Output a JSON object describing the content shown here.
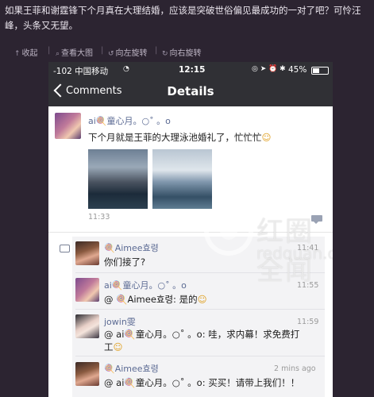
{
  "post": {
    "text": "如果王菲和谢霆锋下个月真在大理结婚，应该是突破世俗偏见最成功的一对了吧？可怜汪峰，头条又无望。"
  },
  "toolbar": {
    "collapse": "收起",
    "view_large": "查看大图",
    "rotate_left": "向左旋转",
    "rotate_right": "向右旋转"
  },
  "status_bar": {
    "carrier": "-102 中国移动",
    "time": "12:15",
    "battery": "45%"
  },
  "nav": {
    "back_label": "Comments",
    "title": "Details"
  },
  "main_post": {
    "username": "ai🍭童心月。○˚ 。o",
    "text": "下个月就是王菲的大理泳池婚礼了，忙忙忙",
    "time": "11:33"
  },
  "comments": [
    {
      "username": "🍭Aimee효령",
      "text": "你们接了?",
      "time": "11:41"
    },
    {
      "username": "ai🍭童心月。○˚ 。o",
      "text": "@ 🍭Aimee효령: 是的",
      "time": "11:55"
    },
    {
      "username": "jowin雯",
      "text": "@ ai🍭童心月。○˚ 。o: 哇，求内幕！求免费打",
      "text2": "工",
      "time": "11:59"
    },
    {
      "username": "🍭Aimee효령",
      "text": "@ ai🍭童心月。○˚ 。o: 买买！请带上我们！！",
      "time": "2 mins ago"
    }
  ],
  "watermark": {
    "cn": "红圈全闻",
    "en": "redquan.com"
  },
  "icons": [
    "arrow-up-icon",
    "zoom-icon",
    "rotate-left-icon",
    "rotate-right-icon",
    "wifi-icon",
    "back-chevron-icon",
    "comment-icon",
    "bubble-icon"
  ]
}
